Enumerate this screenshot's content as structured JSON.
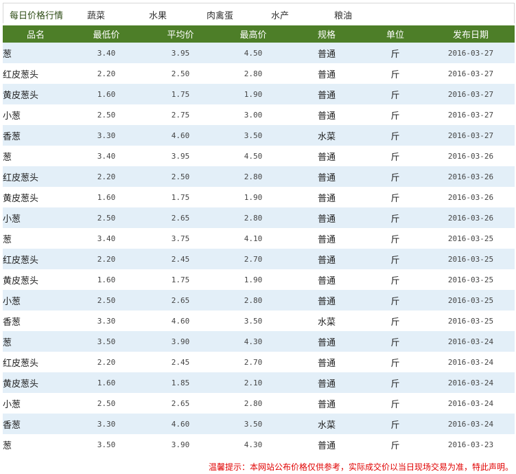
{
  "nav": {
    "tabs": [
      "每日价格行情",
      "蔬菜",
      "水果",
      "肉禽蛋",
      "水产",
      "粮油"
    ]
  },
  "table": {
    "headers": [
      "品名",
      "最低价",
      "平均价",
      "最高价",
      "规格",
      "单位",
      "发布日期"
    ],
    "rows": [
      [
        "葱",
        "3.40",
        "3.95",
        "4.50",
        "普通",
        "斤",
        "2016-03-27"
      ],
      [
        "红皮葱头",
        "2.20",
        "2.50",
        "2.80",
        "普通",
        "斤",
        "2016-03-27"
      ],
      [
        "黄皮葱头",
        "1.60",
        "1.75",
        "1.90",
        "普通",
        "斤",
        "2016-03-27"
      ],
      [
        "小葱",
        "2.50",
        "2.75",
        "3.00",
        "普通",
        "斤",
        "2016-03-27"
      ],
      [
        "香葱",
        "3.30",
        "4.60",
        "3.50",
        "水菜",
        "斤",
        "2016-03-27"
      ],
      [
        "葱",
        "3.40",
        "3.95",
        "4.50",
        "普通",
        "斤",
        "2016-03-26"
      ],
      [
        "红皮葱头",
        "2.20",
        "2.50",
        "2.80",
        "普通",
        "斤",
        "2016-03-26"
      ],
      [
        "黄皮葱头",
        "1.60",
        "1.75",
        "1.90",
        "普通",
        "斤",
        "2016-03-26"
      ],
      [
        "小葱",
        "2.50",
        "2.65",
        "2.80",
        "普通",
        "斤",
        "2016-03-26"
      ],
      [
        "葱",
        "3.40",
        "3.75",
        "4.10",
        "普通",
        "斤",
        "2016-03-25"
      ],
      [
        "红皮葱头",
        "2.20",
        "2.45",
        "2.70",
        "普通",
        "斤",
        "2016-03-25"
      ],
      [
        "黄皮葱头",
        "1.60",
        "1.75",
        "1.90",
        "普通",
        "斤",
        "2016-03-25"
      ],
      [
        "小葱",
        "2.50",
        "2.65",
        "2.80",
        "普通",
        "斤",
        "2016-03-25"
      ],
      [
        "香葱",
        "3.30",
        "4.60",
        "3.50",
        "水菜",
        "斤",
        "2016-03-25"
      ],
      [
        "葱",
        "3.50",
        "3.90",
        "4.30",
        "普通",
        "斤",
        "2016-03-24"
      ],
      [
        "红皮葱头",
        "2.20",
        "2.45",
        "2.70",
        "普通",
        "斤",
        "2016-03-24"
      ],
      [
        "黄皮葱头",
        "1.60",
        "1.85",
        "2.10",
        "普通",
        "斤",
        "2016-03-24"
      ],
      [
        "小葱",
        "2.50",
        "2.65",
        "2.80",
        "普通",
        "斤",
        "2016-03-24"
      ],
      [
        "香葱",
        "3.30",
        "4.60",
        "3.50",
        "水菜",
        "斤",
        "2016-03-24"
      ],
      [
        "葱",
        "3.50",
        "3.90",
        "4.30",
        "普通",
        "斤",
        "2016-03-23"
      ]
    ]
  },
  "footer": {
    "notice": "温馨提示：本网站公布价格仅供参考，实际成交价以当日现场交易为准，特此声明。"
  },
  "colors": {
    "header_bg": "#4d7e28",
    "row_alt_bg": "#e3eff8",
    "notice_text": "#e00000"
  }
}
